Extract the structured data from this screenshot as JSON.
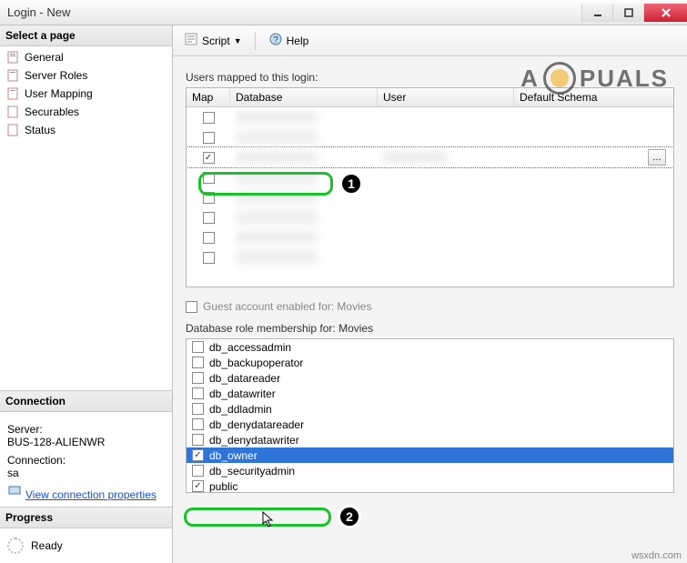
{
  "window": {
    "title": "Login - New"
  },
  "left": {
    "select_page_header": "Select a page",
    "nav": [
      {
        "label": "General"
      },
      {
        "label": "Server Roles"
      },
      {
        "label": "User Mapping"
      },
      {
        "label": "Securables"
      },
      {
        "label": "Status"
      }
    ],
    "connection": {
      "header": "Connection",
      "server_label": "Server:",
      "server_value": "BUS-128-ALIENWR",
      "conn_label": "Connection:",
      "conn_value": "sa",
      "link": "View connection properties"
    },
    "progress": {
      "header": "Progress",
      "status": "Ready"
    }
  },
  "toolbar": {
    "script_label": "Script",
    "help_label": "Help"
  },
  "mapping": {
    "section_label": "Users mapped to this login:",
    "headers": {
      "map": "Map",
      "database": "Database",
      "user": "User",
      "schema": "Default Schema"
    },
    "rows": [
      {
        "checked": false,
        "selected": false
      },
      {
        "checked": false,
        "selected": false
      },
      {
        "checked": true,
        "selected": true
      },
      {
        "checked": false,
        "selected": false
      },
      {
        "checked": false,
        "selected": false
      },
      {
        "checked": false,
        "selected": false
      },
      {
        "checked": false,
        "selected": false
      },
      {
        "checked": false,
        "selected": false
      }
    ]
  },
  "guest": {
    "label": "Guest account enabled for: Movies",
    "checked": false
  },
  "roles": {
    "section_label": "Database role membership for: Movies",
    "items": [
      {
        "label": "db_accessadmin",
        "checked": false,
        "selected": false
      },
      {
        "label": "db_backupoperator",
        "checked": false,
        "selected": false
      },
      {
        "label": "db_datareader",
        "checked": false,
        "selected": false
      },
      {
        "label": "db_datawriter",
        "checked": false,
        "selected": false
      },
      {
        "label": "db_ddladmin",
        "checked": false,
        "selected": false
      },
      {
        "label": "db_denydatareader",
        "checked": false,
        "selected": false
      },
      {
        "label": "db_denydatawriter",
        "checked": false,
        "selected": false
      },
      {
        "label": "db_owner",
        "checked": true,
        "selected": true
      },
      {
        "label": "db_securityadmin",
        "checked": false,
        "selected": false
      },
      {
        "label": "public",
        "checked": true,
        "selected": false
      }
    ]
  },
  "annotations": {
    "badge1": "1",
    "badge2": "2"
  },
  "watermark": {
    "text_left": "A",
    "text_right": "PUALS"
  },
  "footer": "wsxdn.com"
}
